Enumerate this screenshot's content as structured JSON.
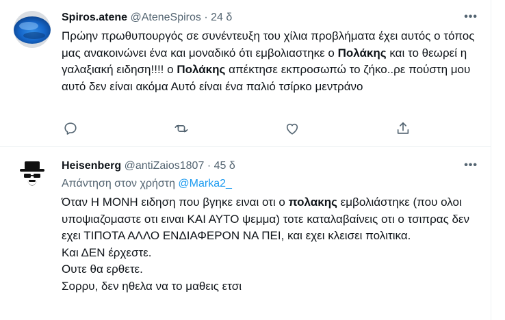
{
  "tweets": [
    {
      "display_name": "Spiros.atene",
      "handle": "@AteneSpiros",
      "separator": "·",
      "time": "24 δ",
      "more": "•••",
      "text": {
        "p1": "Πρώην πρωθυπουργός σε συνέντευξη του χίλια προβλήματα έχει αυτός ο τόπος μας ανακοινώνει ένα και μοναδικό ότι εμβολιαστηκε  ο ",
        "b1": "Πολάκης",
        "p2": " και το θεωρεί η γαλαξιακή ειδηση!!!! ο ",
        "b2": "Πολάκης",
        "p3": " απέκτησε εκπροσωπώ το ζήκο..ρε πούστη μου αυτό δεν είναι ακόμα Αυτό είναι ένα παλιό τσίρκο μεντράνο"
      },
      "actions": [
        "reply-icon",
        "retweet-icon",
        "like-icon",
        "share-icon"
      ]
    },
    {
      "display_name": "Heisenberg",
      "handle": "@antiZaios1807",
      "separator": "·",
      "time": "45 δ",
      "more": "•••",
      "reply_prefix": "Απάντηση στον χρήστη ",
      "reply_to": "@Marka2_",
      "text": {
        "p1": "Όταν Η ΜΟΝΗ ειδηση που βγηκε ειναι οτι ο ",
        "b1": "πολακης",
        "p2": " εμβολιάστηκε (που ολοι υποψιαζομαστε οτι ειναι ΚΑΙ ΑΥΤΟ ψεμμα) τοτε καταλαβαίνεις οτι ο τσιπρας δεν εχει ΤΙΠΟΤΑ ΑΛΛΟ ΕΝΔΙΑΦΕΡΟΝ ΝΑ ΠΕΙ, και εχει κλεισει πολιτικα.",
        "l2": "Και ΔΕΝ έρχεστε.",
        "l3": "Ουτε θα ερθετε.",
        "l4": "Σορρυ, δεν ηθελα να το μαθεις ετσι"
      }
    }
  ],
  "colors": {
    "text": "#0f1419",
    "secondary": "#536471",
    "link": "#1d9bf0",
    "divider": "#eff3f4"
  }
}
